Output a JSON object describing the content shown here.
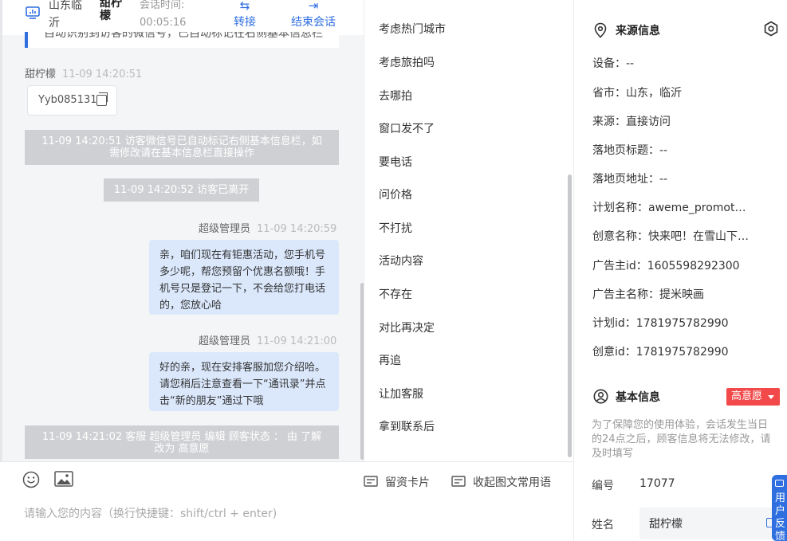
{
  "header": {
    "location": "山东临沂",
    "visitor_name": "甜柠檬",
    "session_time_label": "会话时间:",
    "session_time_value": "00:05:16",
    "transfer_label": "转接",
    "end_label": "结束会话"
  },
  "chat": {
    "cut_card_text": "自动识别到访客的微信号，已自动标记在右侧基本信息栏",
    "messages": [
      {
        "sender": "甜柠檬",
        "time": "11-09 14:20:51",
        "card_text": "Yyb085131"
      },
      {
        "system": "11-09 14:20:51 访客微信号已自动标记右侧基本信息栏，如需修改请在基本信息栏直接操作"
      },
      {
        "system": "11-09 14:20:52 访客已离开"
      },
      {
        "sender": "超级管理员",
        "time": "11-09 14:20:59",
        "text": "亲，咱们现在有钜惠活动，您手机号多少呢，帮您预留个优惠名额哦！手机号只是登记一下，不会给您打电话的，您放心哈"
      },
      {
        "sender": "超级管理员",
        "time": "11-09 14:21:00",
        "text": "好的亲，现在安排客服加您介绍哈。请您稍后注意查看一下“通讯录”并点击“新的朋友”通过下哦"
      },
      {
        "system": "11-09 14:21:02 客服 超级管理员 编辑 顾客状态 ： 由 了解 改为 高意愿"
      }
    ]
  },
  "input": {
    "emoji_icon": "emoji-icon",
    "image_icon": "image-icon",
    "card_label": "留资卡片",
    "phrase_label": "收起图文常用语",
    "placeholder": "请输入您的内容（换行快捷键：shift/ctrl + enter)"
  },
  "phrases": [
    "考虑热门城市",
    "考虑旅拍吗",
    "去哪拍",
    "窗口发不了",
    "要电话",
    "问价格",
    "不打扰",
    "活动内容",
    "不存在",
    "对比再决定",
    "再追",
    "让加客服",
    "拿到联系后"
  ],
  "source_info": {
    "title": "来源信息",
    "items": [
      "设备：--",
      "省市：山东，临沂",
      "来源：直接访问",
      "落地页标题：--",
      "落地页地址：--",
      "计划名称：aweme_promotion",
      "创意名称：快来吧！在雪山下拍婚纱照",
      "广告主id：1605598292300",
      "广告主名称：提米映画",
      "计划id：1781975782990",
      "创意id：1781975782990"
    ]
  },
  "basic_info": {
    "title": "基本信息",
    "intent_badge": "高意愿",
    "notice": "为了保障您的使用体验，会话发生当日的24点之后，顾客信息将无法修改，请及时填写",
    "id_label": "编号",
    "id_value": "17077",
    "name_label": "姓名",
    "name_value": "甜柠檬"
  },
  "float_tab": {
    "label": "用户反馈"
  },
  "colors": {
    "accent": "#2f6fe0",
    "bubble": "#dbe8fc",
    "system_bg": "#cfd0d3",
    "badge_red": "#f24a4a"
  }
}
